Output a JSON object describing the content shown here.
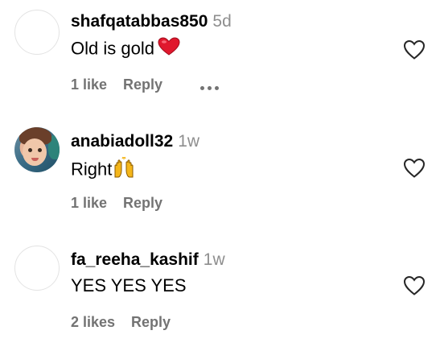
{
  "comments": [
    {
      "username": "shafqatabbas850",
      "time": "5d",
      "text": "Old is gold",
      "emoji": "red-heart",
      "likes": "1 like",
      "reply": "Reply"
    },
    {
      "username": "anabiadoll32",
      "time": "1w",
      "text": "Right",
      "emoji": "raising-hands",
      "likes": "1 like",
      "reply": "Reply"
    },
    {
      "username": "fa_reeha_kashif",
      "time": "1w",
      "text": "YES YES YES",
      "likes": "2 likes",
      "reply": "Reply"
    }
  ],
  "colors": {
    "username": "#000000",
    "secondary": "#8e8e8e",
    "meta": "#737373",
    "heart_emoji": "#e0182d"
  }
}
